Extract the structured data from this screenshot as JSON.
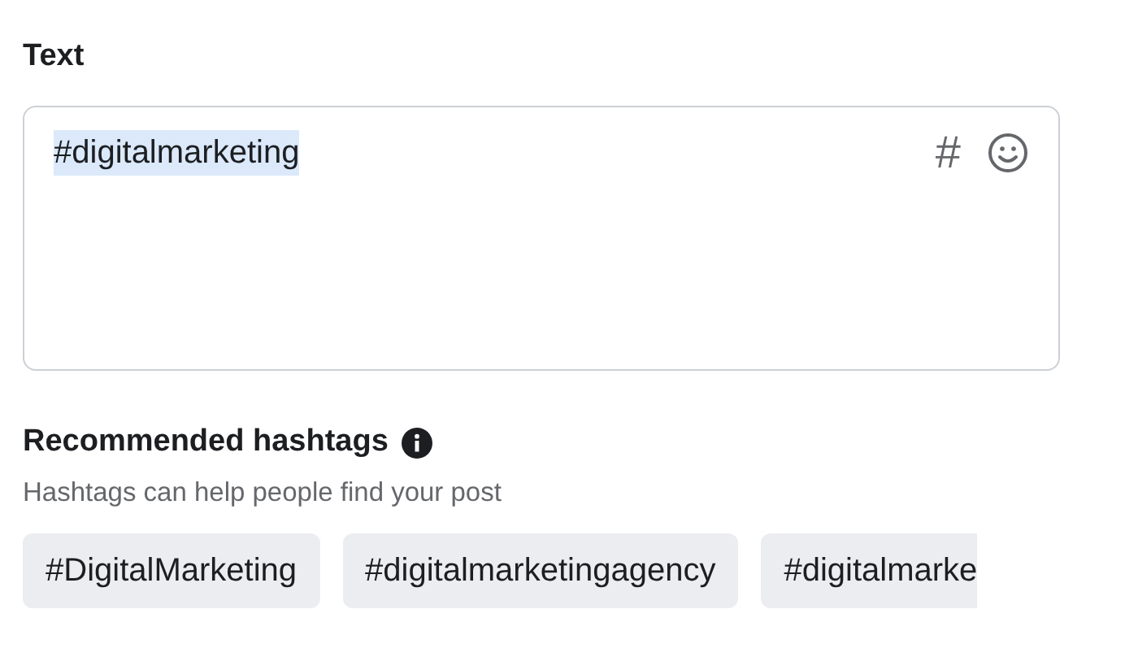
{
  "text_section": {
    "label": "Text",
    "value": "#digitalmarketing",
    "value_highlighted": true,
    "tools": [
      {
        "kind": "hashtag",
        "text": "#"
      },
      {
        "kind": "emoji"
      }
    ]
  },
  "recommended": {
    "title": "Recommended hashtags",
    "subtitle": "Hashtags can help people find your post",
    "hashtags": [
      {
        "text": "#DigitalMarketing",
        "cut": false
      },
      {
        "text": "#digitalmarketingagency",
        "cut": false
      },
      {
        "text": "#digitalmarke",
        "cut": true
      }
    ]
  }
}
